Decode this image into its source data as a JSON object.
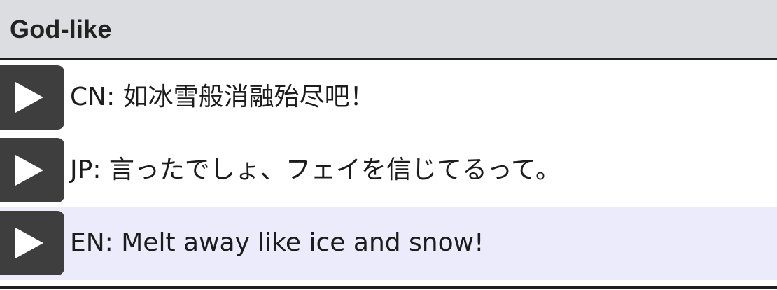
{
  "header": {
    "title": "God-like"
  },
  "lines": [
    {
      "text": "CN: 如冰雪般消融殆尽吧！",
      "icon": "play-icon"
    },
    {
      "text": "JP: 言ったでしょ、フェイを信じてるって。",
      "icon": "play-icon"
    },
    {
      "text": "EN: Melt away like ice and snow!",
      "icon": "play-icon",
      "highlighted": true
    }
  ],
  "colors": {
    "header_bg": "#dcdde1",
    "button_bg": "#3e3e3e",
    "highlight_bg": "#ebebfb",
    "border": "#1e1e1e"
  }
}
